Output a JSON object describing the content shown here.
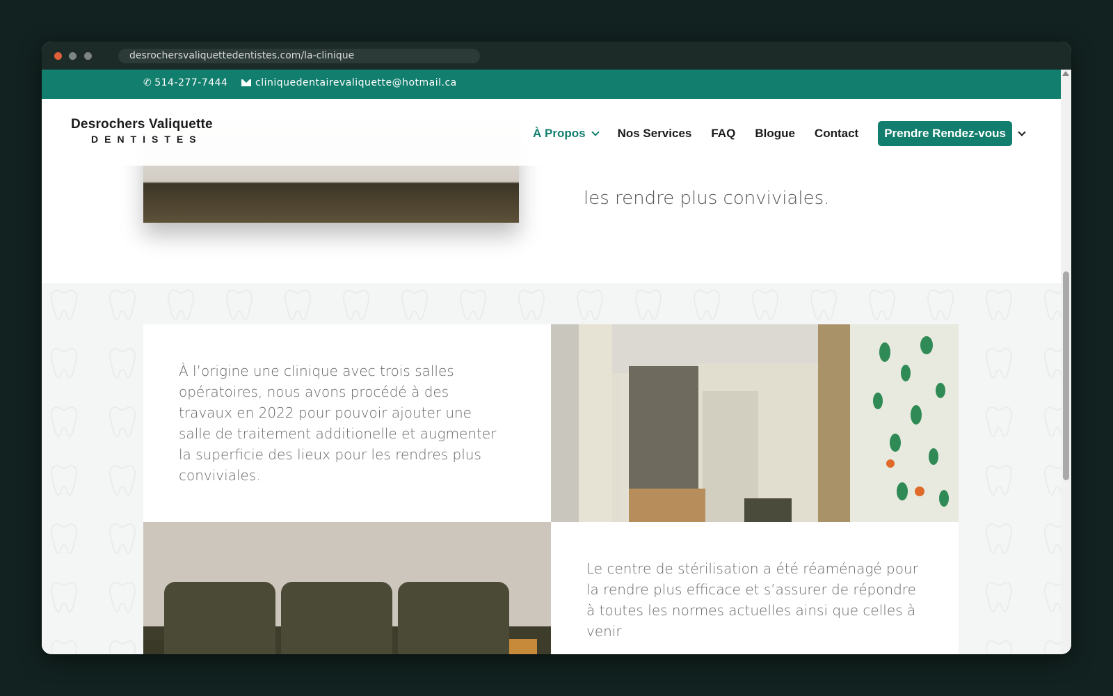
{
  "browser": {
    "url": "desrochersvaliquettedentistes.com/la-clinique"
  },
  "topbar": {
    "phone": "514-277-7444",
    "email": "cliniquedentairevaliquette@hotmail.ca"
  },
  "header": {
    "logo_main": "Desrochers Valiquette",
    "logo_sub": "DENTISTES",
    "nav": {
      "apropos": "À Propos",
      "services": "Nos Services",
      "faq": "FAQ",
      "blogue": "Blogue",
      "contact": "Contact",
      "cta": "Prendre Rendez-vous"
    }
  },
  "hero": {
    "text_fragment": "les rendre plus conviviales."
  },
  "cards": {
    "text1": "À l’origine une clinique avec trois salles opératoires, nous avons procédé à des travaux en 2022 pour pouvoir ajouter une salle de traitement additionelle et augmenter la superficie des lieux pour les rendres plus conviviales.",
    "text2": "Le centre de stérilisation a été réaménagé pour la rendre plus efficace et s’assurer de répondre à toutes les normes actuelles ainsi que celles à venir"
  },
  "colors": {
    "brand": "#127e6d",
    "background": "#122220"
  }
}
